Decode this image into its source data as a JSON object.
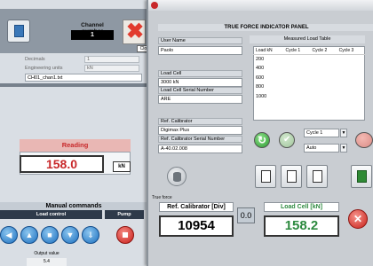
{
  "background_window": {
    "channel_number": {
      "label": "Channel number",
      "value": "1"
    },
    "close_tooltip": "Close",
    "config": {
      "decimals_label": "Decimals",
      "decimals_value": "1",
      "engineering_units_label": "Engineering units",
      "engineering_units_value": "kN",
      "file_name": "CH01_chan1.txt"
    },
    "reading": {
      "title": "Reading",
      "value": "158.0",
      "unit": "kN"
    },
    "manual_commands": {
      "title": "Manual commands",
      "load_control_label": "Load control",
      "pump_label": "Pump",
      "output_value_label": "Output value",
      "output_value": "5.4"
    }
  },
  "panel": {
    "title": "TRUE FORCE INDICATOR PANEL",
    "fields": {
      "user_name_label": "User Name",
      "user_name_value": "Paolo",
      "load_cell_label": "Load Cell",
      "load_cell_value": "3000 kN",
      "load_cell_serial_label": "Load Cell Serial Number",
      "load_cell_serial_value": "ARE",
      "ref_calibrator_label": "Ref. Calibrator",
      "ref_calibrator_value": "Digimax Plus",
      "ref_calibrator_serial_label": "Ref. Calibrator Serial Number",
      "ref_calibrator_serial_value": "A-40.02.008"
    },
    "measured_load_table": {
      "title": "Measured Load Table",
      "columns": [
        "Load kN",
        "Cycle 1",
        "Cycle 2",
        "Cycle 3"
      ],
      "rows": [
        "200",
        "400",
        "600",
        "800",
        "1000"
      ]
    },
    "cycle_select": "Cycle 1",
    "mode_select": "Auto",
    "true_force": {
      "group_label": "True force",
      "calibrator_title": "Ref. Calibrator [Div]",
      "calibrator_value": "10954",
      "zero_button": "0.0",
      "load_cell_title": "Load Cell [kN]",
      "load_cell_value": "158.2"
    },
    "colors": {
      "reading_red": "#c8282a",
      "load_cell_green": "#2d8a3f"
    }
  }
}
